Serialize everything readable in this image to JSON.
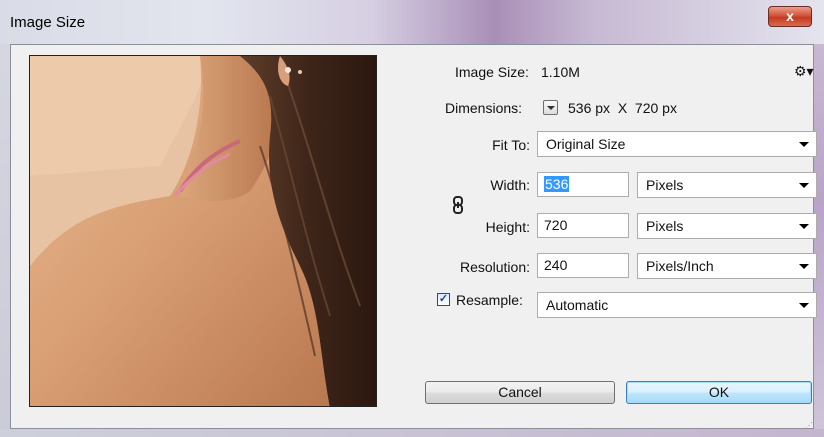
{
  "window": {
    "title": "Image Size",
    "close_label": "x"
  },
  "info": {
    "image_size_label": "Image Size:",
    "image_size_value": "1.10M",
    "dimensions_label": "Dimensions:",
    "dimensions_value": "536 px  X  720 px"
  },
  "fit_to": {
    "label": "Fit To:",
    "value": "Original Size"
  },
  "width": {
    "label": "Width:",
    "value": "536",
    "unit": "Pixels"
  },
  "height": {
    "label": "Height:",
    "value": "720",
    "unit": "Pixels"
  },
  "resolution": {
    "label": "Resolution:",
    "value": "240",
    "unit": "Pixels/Inch"
  },
  "resample": {
    "label": "Resample:",
    "checked": true,
    "check_mark": "✓",
    "value": "Automatic"
  },
  "buttons": {
    "cancel": "Cancel",
    "ok": "OK"
  },
  "icons": {
    "settings": "gear-icon",
    "link": "chain-link-icon",
    "dimensions_menu": "dropdown-icon"
  },
  "colors": {
    "ok_accent": "#3c7fb1",
    "selection": "#3399ff",
    "close_button": "#c43a20"
  }
}
